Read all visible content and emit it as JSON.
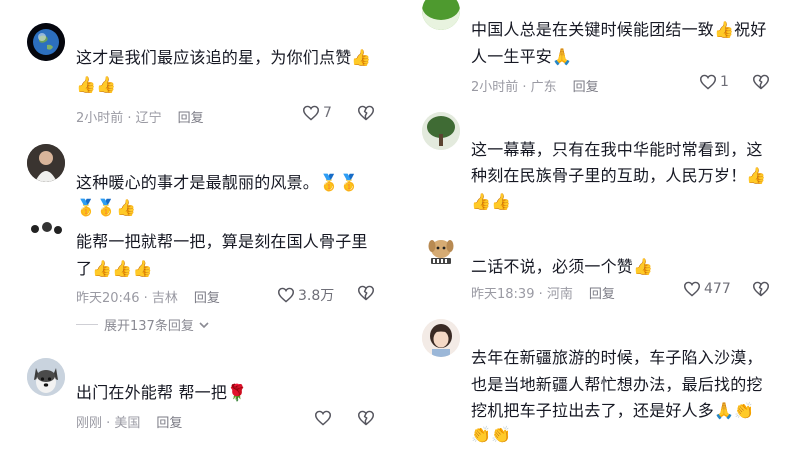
{
  "left": [
    {
      "text": "这才是我们最应该追的星，为你们点赞👍",
      "text2": "👍👍",
      "time": "2小时前 · 辽宁",
      "reply": "回复",
      "likes": "7"
    },
    {
      "text": "这种暖心的事才是最靓丽的风景。🥇🥇",
      "text2": "🥇🥇👍",
      "time": "",
      "reply": "",
      "likes": ""
    },
    {
      "text": "能帮一把就帮一把，算是刻在国人骨子里",
      "text2": "了👍👍👍",
      "time": "昨天20:46 · 吉林",
      "reply": "回复",
      "likes": "3.8万"
    },
    {
      "text": "出门在外能帮 帮一把🌹",
      "time": "刚刚 · 美国",
      "reply": "回复",
      "likes": ""
    }
  ],
  "expand_label": "展开137条回复",
  "right": [
    {
      "text": "中国人总是在关键时候能团结一致👍祝好",
      "text2": "人一生平安🙏",
      "time": "2小时前 · 广东",
      "reply": "回复",
      "likes": "1"
    },
    {
      "text": "这一幕幕，只有在我中华能时常看到，这",
      "text2": "种刻在民族骨子里的互助，人民万岁！👍",
      "text3": "👍👍",
      "time": "",
      "reply": "",
      "likes": ""
    },
    {
      "text": "二话不说，必须一个赞👍",
      "time": "昨天18:39 · 河南",
      "reply": "回复",
      "likes": "477"
    },
    {
      "text": "去年在新疆旅游的时候，车子陷入沙漠，",
      "text2": "也是当地新疆人帮忙想办法，最后找的挖",
      "text3": "挖机把车子拉出去了，还是好人多🙏👏",
      "text4": "👏👏",
      "time": "",
      "reply": "",
      "likes": ""
    }
  ],
  "colors": {
    "text": "#161823",
    "meta": "#9a9aa3",
    "background": "#ffffff"
  },
  "icons": [
    "heart-icon",
    "dislike-heart-icon",
    "chevron-down-icon"
  ]
}
